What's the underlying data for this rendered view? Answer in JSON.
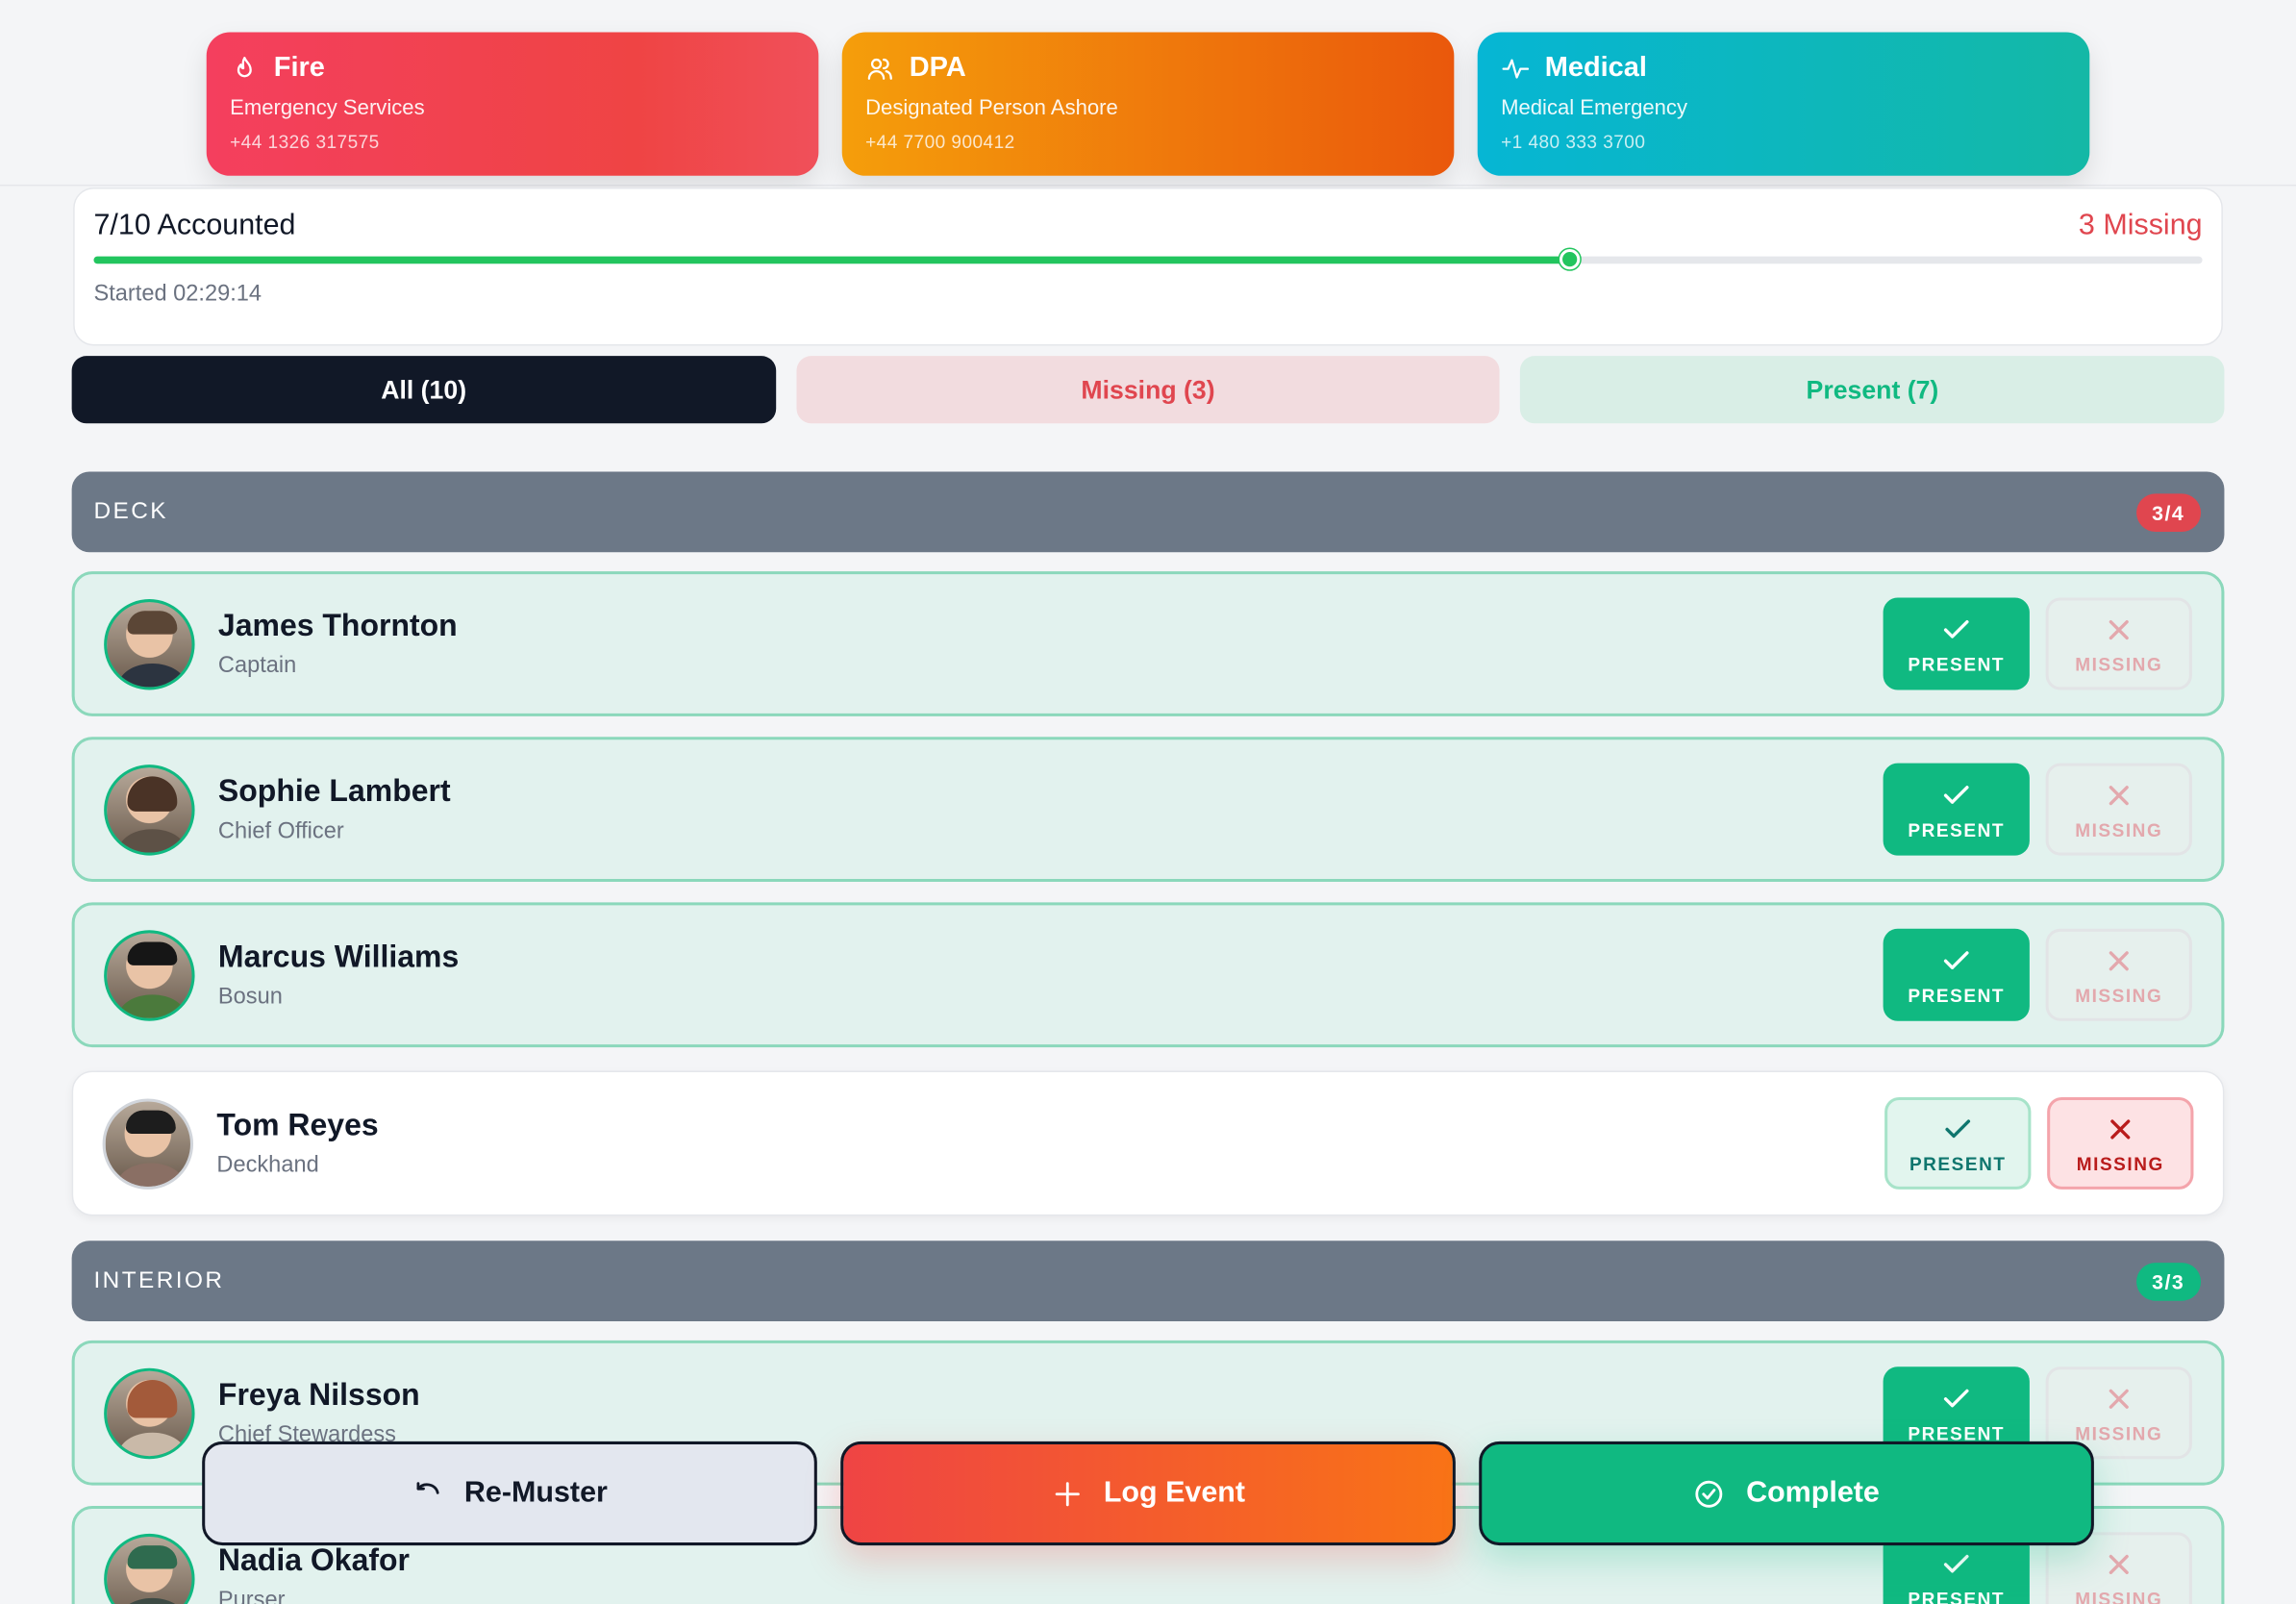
{
  "colors": {
    "fire_from": "#f43f5e",
    "fire_to": "#ef4444",
    "dpa_from": "#f59e0b",
    "dpa_to": "#ea580c",
    "medical_from": "#06b6d4",
    "medical_to": "#14b8a6",
    "present": "#10b981",
    "missing": "#e0464f"
  },
  "contacts": [
    {
      "icon": "flame-icon",
      "title": "Fire",
      "subtitle": "Emergency Services",
      "phone": "+44 1326 317575"
    },
    {
      "icon": "people-icon",
      "title": "DPA",
      "subtitle": "Designated Person Ashore",
      "phone": "+44 7700 900412"
    },
    {
      "icon": "pulse-icon",
      "title": "Medical",
      "subtitle": "Medical Emergency",
      "phone": "+1 480 333 3700"
    }
  ],
  "muster": {
    "accounted_label": "7/10 Accounted",
    "missing_label": "3 Missing",
    "progress_fraction": 0.7,
    "started_label": "Started 02:29:14"
  },
  "filters": {
    "all": "All (10)",
    "missing": "Missing (3)",
    "present": "Present (7)"
  },
  "groups": [
    {
      "name": "DECK",
      "count": "3/4",
      "people": [
        {
          "name": "James Thornton",
          "role": "Captain",
          "status": "present"
        },
        {
          "name": "Sophie Lambert",
          "role": "Chief Officer",
          "status": "present"
        },
        {
          "name": "Marcus Williams",
          "role": "Bosun",
          "status": "present"
        },
        {
          "name": "Tom Reyes",
          "role": "Deckhand",
          "status": "missing"
        }
      ]
    },
    {
      "name": "INTERIOR",
      "count": "3/3",
      "people": [
        {
          "name": "Freya Nilsson",
          "role": "Chief Stewardess",
          "status": "present"
        },
        {
          "name": "Nadia Okafor",
          "role": "Purser",
          "status": "present"
        }
      ]
    }
  ],
  "buttons": {
    "present": "PRESENT",
    "missing": "MISSING"
  },
  "actions": {
    "remuster": "Re-Muster",
    "log_event": "Log Event",
    "complete": "Complete"
  }
}
